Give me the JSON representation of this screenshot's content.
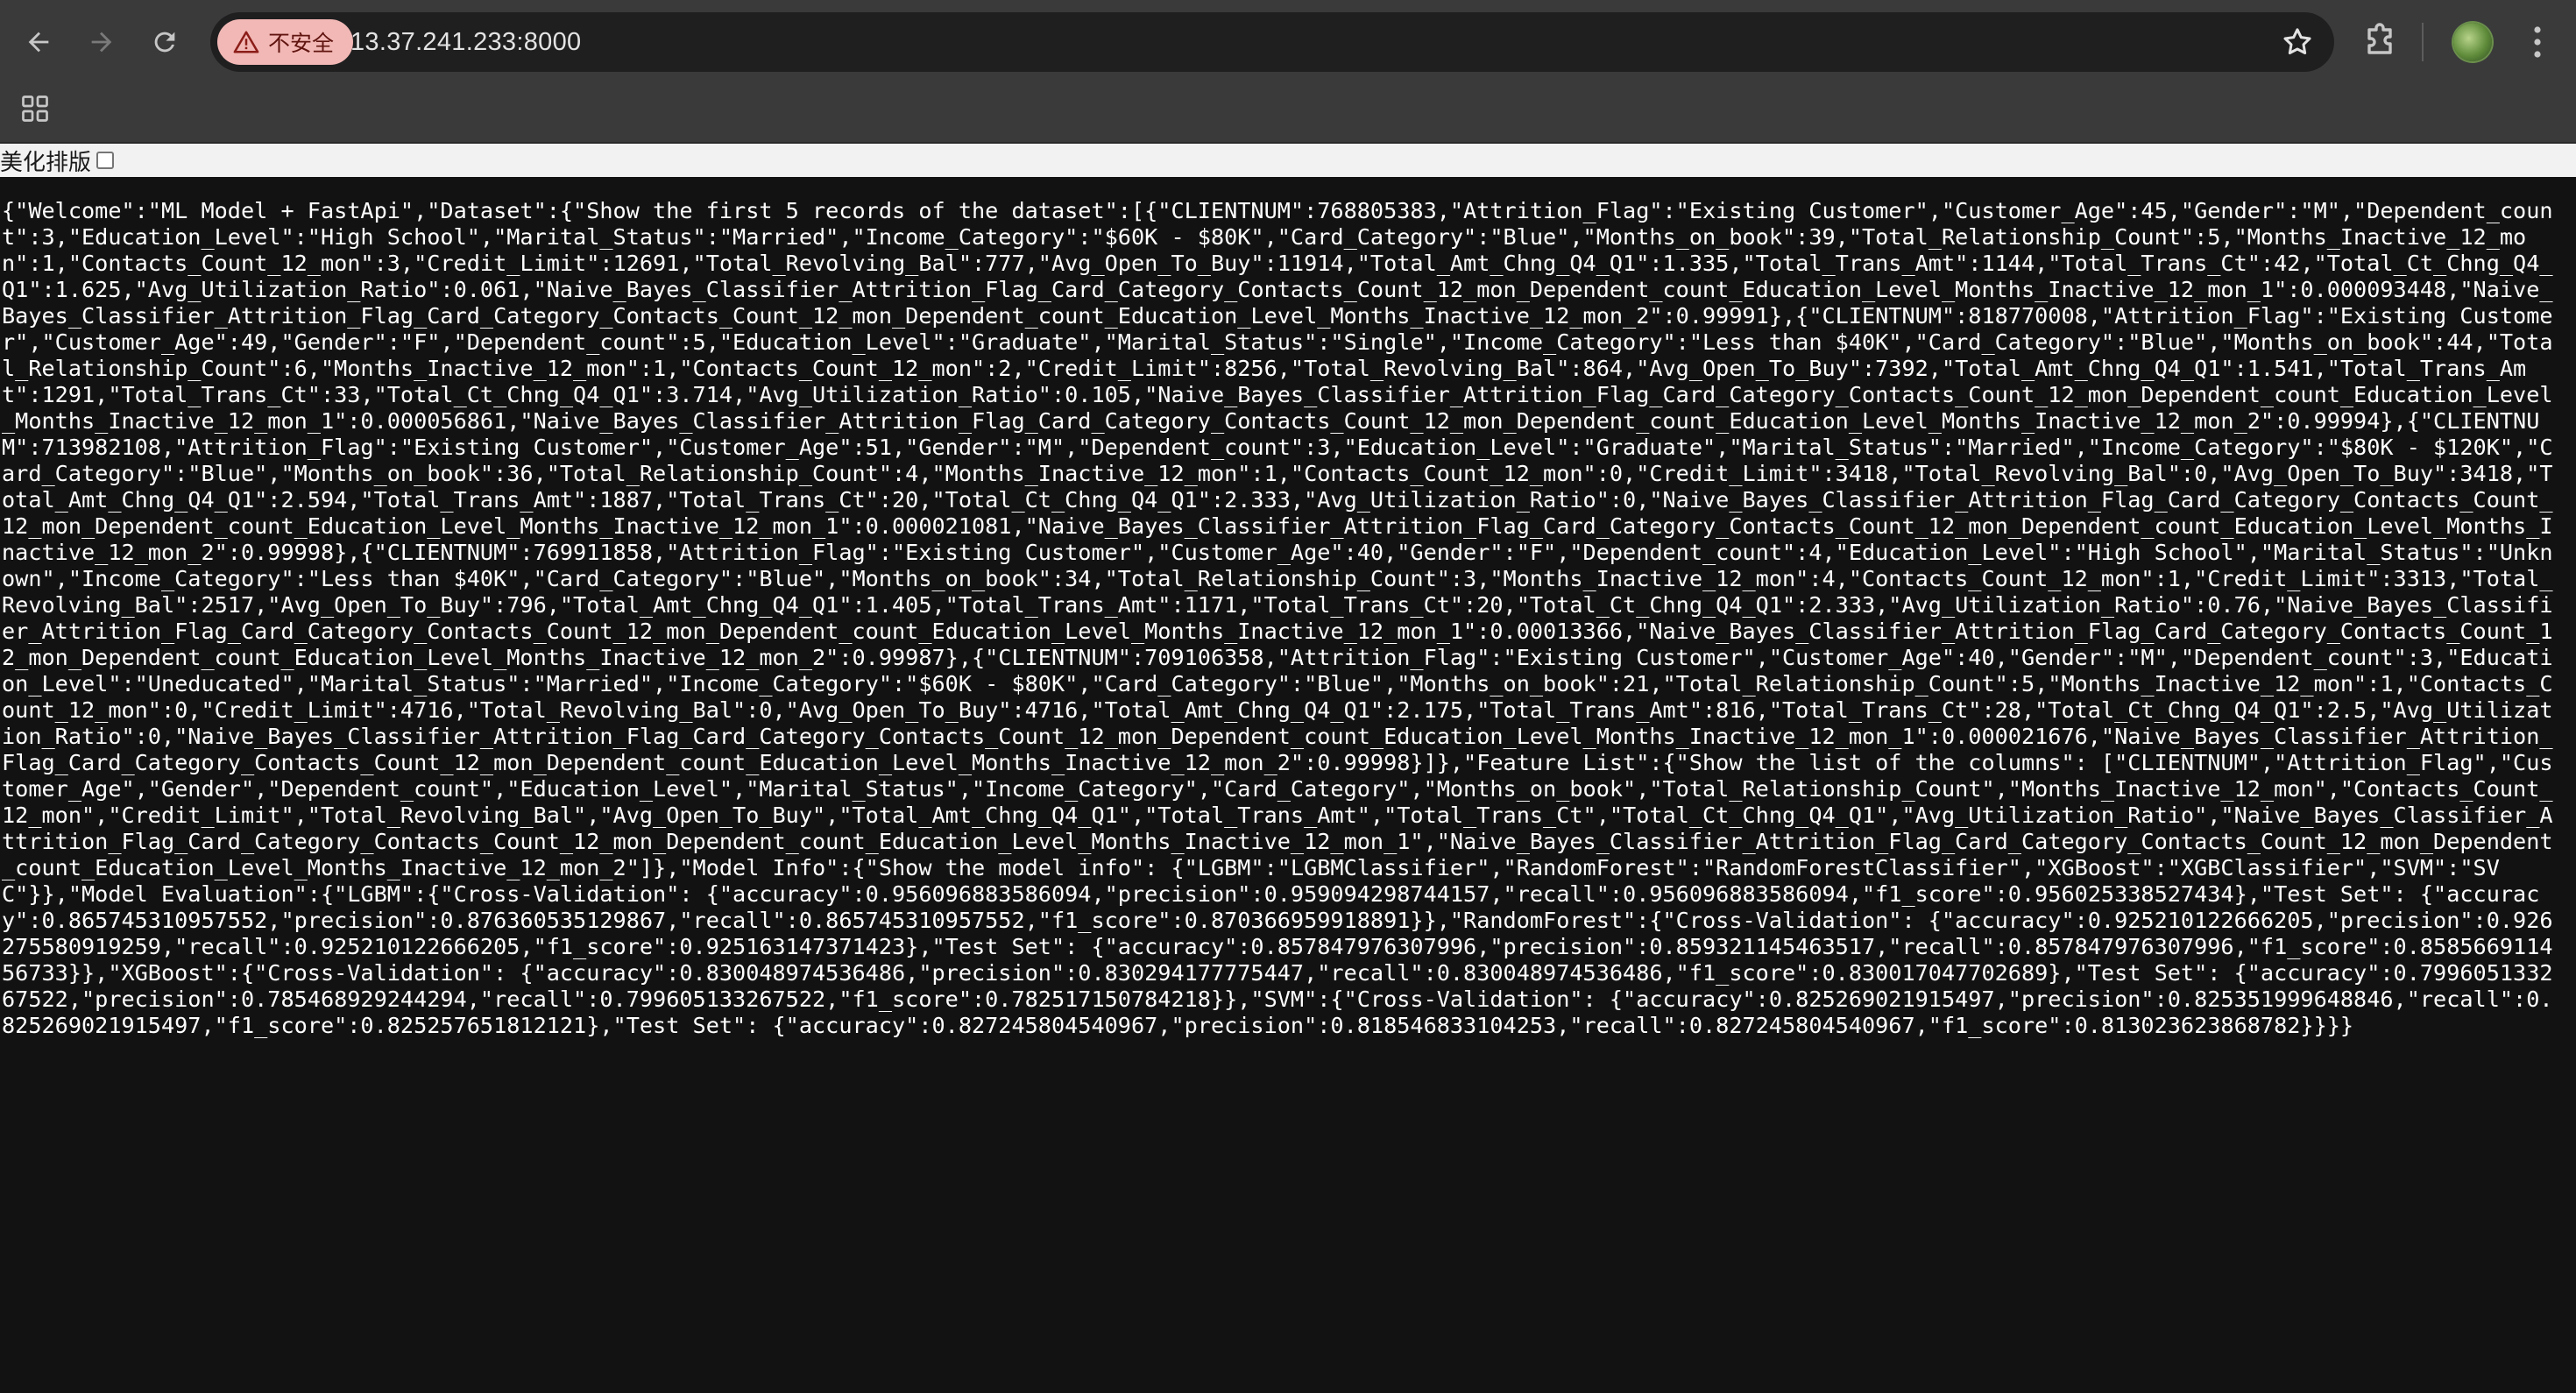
{
  "browser": {
    "security_label": "不安全",
    "url": "13.37.241.233:8000"
  },
  "colors": {
    "toolbar": "#3a3a3b",
    "omnibox": "#1f1f20",
    "insecure_chip": "#f2b8b5",
    "page_background": "#121212",
    "text": "#ffffff"
  },
  "icons": {
    "back": "arrow-left-icon",
    "forward": "arrow-right-icon",
    "reload": "reload-icon",
    "warning": "warning-triangle-icon",
    "bookmark": "star-icon",
    "extensions": "puzzle-icon",
    "profile": "avatar",
    "menu": "kebab-menu-icon",
    "apps": "apps-grid-icon"
  },
  "pretty_print": {
    "label": "美化排版",
    "checked": false
  },
  "json_text": "{\"Welcome\":\"ML Model + FastApi\",\"Dataset\":{\"Show the first 5 records of the dataset\":[{\"CLIENTNUM\":768805383,\"Attrition_Flag\":\"Existing Customer\",\"Customer_Age\":45,\"Gender\":\"M\",\"Dependent_count\":3,\"Education_Level\":\"High School\",\"Marital_Status\":\"Married\",\"Income_Category\":\"$60K - $80K\",\"Card_Category\":\"Blue\",\"Months_on_book\":39,\"Total_Relationship_Count\":5,\"Months_Inactive_12_mon\":1,\"Contacts_Count_12_mon\":3,\"Credit_Limit\":12691,\"Total_Revolving_Bal\":777,\"Avg_Open_To_Buy\":11914,\"Total_Amt_Chng_Q4_Q1\":1.335,\"Total_Trans_Amt\":1144,\"Total_Trans_Ct\":42,\"Total_Ct_Chng_Q4_Q1\":1.625,\"Avg_Utilization_Ratio\":0.061,\"Naive_Bayes_Classifier_Attrition_Flag_Card_Category_Contacts_Count_12_mon_Dependent_count_Education_Level_Months_Inactive_12_mon_1\":0.000093448,\"Naive_Bayes_Classifier_Attrition_Flag_Card_Category_Contacts_Count_12_mon_Dependent_count_Education_Level_Months_Inactive_12_mon_2\":0.99991},{\"CLIENTNUM\":818770008,\"Attrition_Flag\":\"Existing Customer\",\"Customer_Age\":49,\"Gender\":\"F\",\"Dependent_count\":5,\"Education_Level\":\"Graduate\",\"Marital_Status\":\"Single\",\"Income_Category\":\"Less than $40K\",\"Card_Category\":\"Blue\",\"Months_on_book\":44,\"Total_Relationship_Count\":6,\"Months_Inactive_12_mon\":1,\"Contacts_Count_12_mon\":2,\"Credit_Limit\":8256,\"Total_Revolving_Bal\":864,\"Avg_Open_To_Buy\":7392,\"Total_Amt_Chng_Q4_Q1\":1.541,\"Total_Trans_Amt\":1291,\"Total_Trans_Ct\":33,\"Total_Ct_Chng_Q4_Q1\":3.714,\"Avg_Utilization_Ratio\":0.105,\"Naive_Bayes_Classifier_Attrition_Flag_Card_Category_Contacts_Count_12_mon_Dependent_count_Education_Level_Months_Inactive_12_mon_1\":0.000056861,\"Naive_Bayes_Classifier_Attrition_Flag_Card_Category_Contacts_Count_12_mon_Dependent_count_Education_Level_Months_Inactive_12_mon_2\":0.99994},{\"CLIENTNUM\":713982108,\"Attrition_Flag\":\"Existing Customer\",\"Customer_Age\":51,\"Gender\":\"M\",\"Dependent_count\":3,\"Education_Level\":\"Graduate\",\"Marital_Status\":\"Married\",\"Income_Category\":\"$80K - $120K\",\"Card_Category\":\"Blue\",\"Months_on_book\":36,\"Total_Relationship_Count\":4,\"Months_Inactive_12_mon\":1,\"Contacts_Count_12_mon\":0,\"Credit_Limit\":3418,\"Total_Revolving_Bal\":0,\"Avg_Open_To_Buy\":3418,\"Total_Amt_Chng_Q4_Q1\":2.594,\"Total_Trans_Amt\":1887,\"Total_Trans_Ct\":20,\"Total_Ct_Chng_Q4_Q1\":2.333,\"Avg_Utilization_Ratio\":0,\"Naive_Bayes_Classifier_Attrition_Flag_Card_Category_Contacts_Count_12_mon_Dependent_count_Education_Level_Months_Inactive_12_mon_1\":0.000021081,\"Naive_Bayes_Classifier_Attrition_Flag_Card_Category_Contacts_Count_12_mon_Dependent_count_Education_Level_Months_Inactive_12_mon_2\":0.99998},{\"CLIENTNUM\":769911858,\"Attrition_Flag\":\"Existing Customer\",\"Customer_Age\":40,\"Gender\":\"F\",\"Dependent_count\":4,\"Education_Level\":\"High School\",\"Marital_Status\":\"Unknown\",\"Income_Category\":\"Less than $40K\",\"Card_Category\":\"Blue\",\"Months_on_book\":34,\"Total_Relationship_Count\":3,\"Months_Inactive_12_mon\":4,\"Contacts_Count_12_mon\":1,\"Credit_Limit\":3313,\"Total_Revolving_Bal\":2517,\"Avg_Open_To_Buy\":796,\"Total_Amt_Chng_Q4_Q1\":1.405,\"Total_Trans_Amt\":1171,\"Total_Trans_Ct\":20,\"Total_Ct_Chng_Q4_Q1\":2.333,\"Avg_Utilization_Ratio\":0.76,\"Naive_Bayes_Classifier_Attrition_Flag_Card_Category_Contacts_Count_12_mon_Dependent_count_Education_Level_Months_Inactive_12_mon_1\":0.00013366,\"Naive_Bayes_Classifier_Attrition_Flag_Card_Category_Contacts_Count_12_mon_Dependent_count_Education_Level_Months_Inactive_12_mon_2\":0.99987},{\"CLIENTNUM\":709106358,\"Attrition_Flag\":\"Existing Customer\",\"Customer_Age\":40,\"Gender\":\"M\",\"Dependent_count\":3,\"Education_Level\":\"Uneducated\",\"Marital_Status\":\"Married\",\"Income_Category\":\"$60K - $80K\",\"Card_Category\":\"Blue\",\"Months_on_book\":21,\"Total_Relationship_Count\":5,\"Months_Inactive_12_mon\":1,\"Contacts_Count_12_mon\":0,\"Credit_Limit\":4716,\"Total_Revolving_Bal\":0,\"Avg_Open_To_Buy\":4716,\"Total_Amt_Chng_Q4_Q1\":2.175,\"Total_Trans_Amt\":816,\"Total_Trans_Ct\":28,\"Total_Ct_Chng_Q4_Q1\":2.5,\"Avg_Utilization_Ratio\":0,\"Naive_Bayes_Classifier_Attrition_Flag_Card_Category_Contacts_Count_12_mon_Dependent_count_Education_Level_Months_Inactive_12_mon_1\":0.000021676,\"Naive_Bayes_Classifier_Attrition_Flag_Card_Category_Contacts_Count_12_mon_Dependent_count_Education_Level_Months_Inactive_12_mon_2\":0.99998}]},\"Feature List\":{\"Show the list of the columns\": [\"CLIENTNUM\",\"Attrition_Flag\",\"Customer_Age\",\"Gender\",\"Dependent_count\",\"Education_Level\",\"Marital_Status\",\"Income_Category\",\"Card_Category\",\"Months_on_book\",\"Total_Relationship_Count\",\"Months_Inactive_12_mon\",\"Contacts_Count_12_mon\",\"Credit_Limit\",\"Total_Revolving_Bal\",\"Avg_Open_To_Buy\",\"Total_Amt_Chng_Q4_Q1\",\"Total_Trans_Amt\",\"Total_Trans_Ct\",\"Total_Ct_Chng_Q4_Q1\",\"Avg_Utilization_Ratio\",\"Naive_Bayes_Classifier_Attrition_Flag_Card_Category_Contacts_Count_12_mon_Dependent_count_Education_Level_Months_Inactive_12_mon_1\",\"Naive_Bayes_Classifier_Attrition_Flag_Card_Category_Contacts_Count_12_mon_Dependent_count_Education_Level_Months_Inactive_12_mon_2\"]},\"Model Info\":{\"Show the model info\": {\"LGBM\":\"LGBMClassifier\",\"RandomForest\":\"RandomForestClassifier\",\"XGBoost\":\"XGBClassifier\",\"SVM\":\"SVC\"}},\"Model Evaluation\":{\"LGBM\":{\"Cross-Validation\": {\"accuracy\":0.956096883586094,\"precision\":0.959094298744157,\"recall\":0.956096883586094,\"f1_score\":0.956025338527434},\"Test Set\": {\"accuracy\":0.865745310957552,\"precision\":0.876360535129867,\"recall\":0.865745310957552,\"f1_score\":0.870366959918891}},\"RandomForest\":{\"Cross-Validation\": {\"accuracy\":0.925210122666205,\"precision\":0.926275580919259,\"recall\":0.925210122666205,\"f1_score\":0.925163147371423},\"Test Set\": {\"accuracy\":0.857847976307996,\"precision\":0.859321145463517,\"recall\":0.857847976307996,\"f1_score\":0.858566911456733}},\"XGBoost\":{\"Cross-Validation\": {\"accuracy\":0.830048974536486,\"precision\":0.830294177775447,\"recall\":0.830048974536486,\"f1_score\":0.830017047702689},\"Test Set\": {\"accuracy\":0.799605133267522,\"precision\":0.785468929244294,\"recall\":0.799605133267522,\"f1_score\":0.782517150784218}},\"SVM\":{\"Cross-Validation\": {\"accuracy\":0.825269021915497,\"precision\":0.825351999648846,\"recall\":0.825269021915497,\"f1_score\":0.825257651812121},\"Test Set\": {\"accuracy\":0.827245804540967,\"precision\":0.818546833104253,\"recall\":0.827245804540967,\"f1_score\":0.813023623868782}}}}"
}
